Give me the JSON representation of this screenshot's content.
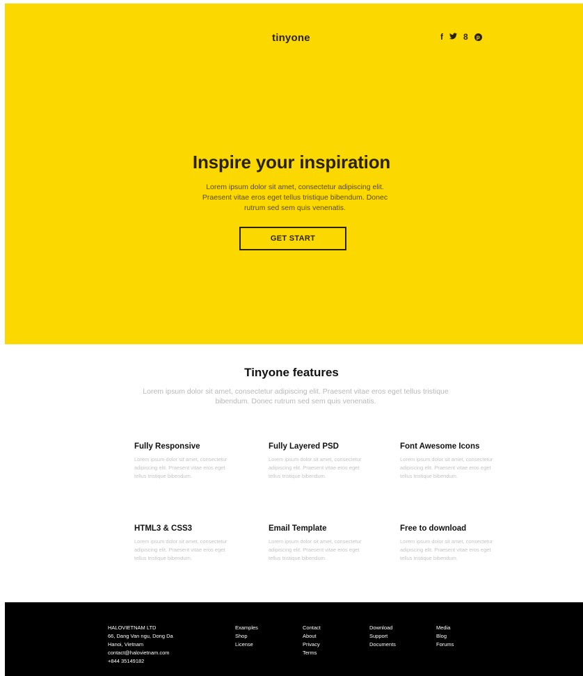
{
  "header": {
    "logo": "tinyone",
    "social": [
      "f",
      "y",
      "8",
      "p"
    ]
  },
  "hero": {
    "title": "Inspire your inspiration",
    "text": "Lorem ipsum dolor sit amet, consectetur adipiscing elit. Praesent vitae eros eget tellus tristique bibendum. Donec rutrum sed sem quis venenatis.",
    "button_label": "GET START"
  },
  "features": {
    "title": "Tinyone features",
    "subtitle": "Lorem ipsum dolor sit amet, consectetur adipiscing elit. Praesent vitae eros eget tellus tristique bibendum. Donec rutrum sed sem quis venenatis.",
    "items": [
      {
        "title": "Fully Responsive",
        "text": "Lorem ipsum dolor sit amet, consectetur adipiscing elit. Praesent vitae eros eget tellus tristique bibendum."
      },
      {
        "title": "Fully Layered PSD",
        "text": "Lorem ipsum dolor sit amet, consectetur adipiscing elit. Praesent vitae eros eget tellus tristique bibendum."
      },
      {
        "title": "Font Awesome Icons",
        "text": "Lorem ipsum dolor sit amet, consectetur adipiscing elit. Praesent vitae eros eget tellus tristique bibendum."
      },
      {
        "title": "HTML3 & CSS3",
        "text": "Lorem ipsum dolor sit amet, consectetur adipiscing elit. Praesent vitae eros eget tellus tristique bibendum."
      },
      {
        "title": "Email Template",
        "text": "Lorem ipsum dolor sit amet, consectetur adipiscing elit. Praesent vitae eros eget tellus tristique bibendum."
      },
      {
        "title": "Free to download",
        "text": "Lorem ipsum dolor sit amet, consectetur adipiscing elit. Praesent vitae eros eget tellus tristique bibendum."
      }
    ]
  },
  "footer": {
    "company": [
      "HALOVIETNAM LTD",
      "66, Dang Van ngu, Dong Da",
      "Hanoi, Vietnam",
      "contact@halovietnam.com",
      "+844 35149182"
    ],
    "links1": [
      "Examples",
      "Shop",
      "License"
    ],
    "links2": [
      "Contact",
      "About",
      "Privacy",
      "Terms"
    ],
    "links3": [
      "Download",
      "Support",
      "Documents"
    ],
    "links4": [
      "Media",
      "Blog",
      "Forums"
    ]
  }
}
